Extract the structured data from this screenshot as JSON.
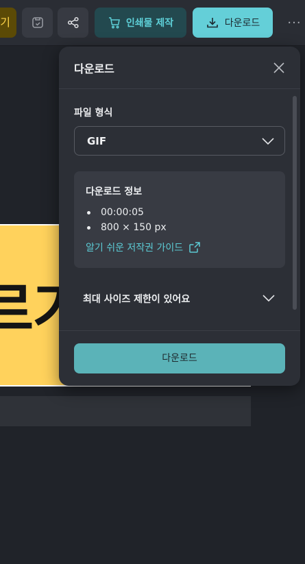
{
  "toolbar": {
    "left_partial_label": "기",
    "print_label": "인쇄물 제작",
    "download_label": "다운로드",
    "more_label": "···",
    "icons": [
      "save-icon",
      "share-icon",
      "cart-icon",
      "download-icon",
      "more-icon"
    ]
  },
  "canvas": {
    "banner_text": "르기"
  },
  "panel": {
    "title": "다운로드",
    "format_label": "파일 형식",
    "format_value": "GIF",
    "info": {
      "title": "다운로드 정보",
      "items": [
        "00:00:05",
        "800 × 150 px"
      ],
      "guide_link": "알기 쉬운 저작권 가이드"
    },
    "size_limit_label": "최대 사이즈 제한이 있어요",
    "download_button": "다운로드"
  },
  "colors": {
    "accent": "#64cfd8",
    "link": "#5ccbd5",
    "panel_bg": "#2c2f36",
    "banner": "#ffd25c"
  }
}
